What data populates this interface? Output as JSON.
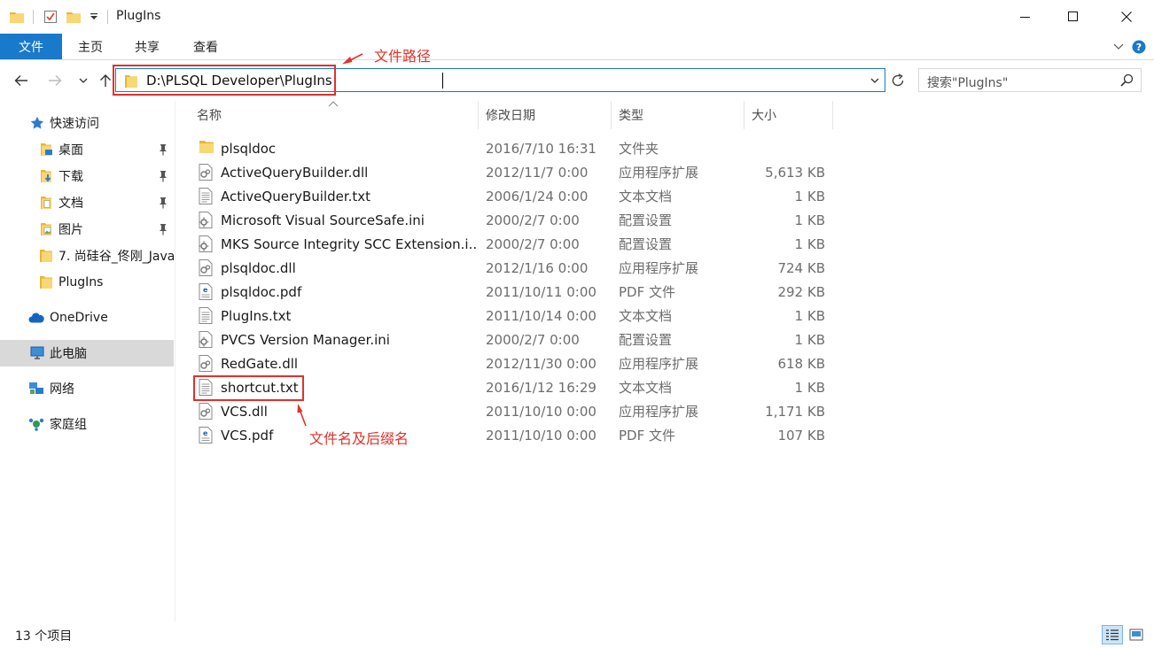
{
  "window": {
    "title": "PlugIns",
    "controls": [
      "minimize",
      "maximize",
      "close"
    ]
  },
  "ribbon": {
    "tabs": [
      {
        "label": "文件",
        "active": true
      },
      {
        "label": "主页"
      },
      {
        "label": "共享"
      },
      {
        "label": "查看"
      }
    ]
  },
  "navigation": {
    "address": "D:\\PLSQL Developer\\PlugIns",
    "search_placeholder": "搜索\"PlugIns\""
  },
  "sidebar": {
    "items": [
      {
        "label": "快速访问",
        "icon": "star-icon",
        "pinned": false
      },
      {
        "label": "桌面",
        "icon": "desktop-folder-icon",
        "pinned": true
      },
      {
        "label": "下载",
        "icon": "download-folder-icon",
        "pinned": true
      },
      {
        "label": "文档",
        "icon": "documents-folder-icon",
        "pinned": true
      },
      {
        "label": "图片",
        "icon": "pictures-folder-icon",
        "pinned": true
      },
      {
        "label": "7. 尚硅谷_佟刚_Java",
        "icon": "folder-icon",
        "pinned": false
      },
      {
        "label": "PlugIns",
        "icon": "folder-icon",
        "pinned": false
      },
      {
        "label": "OneDrive",
        "icon": "cloud-icon",
        "pinned": false
      },
      {
        "label": "此电脑",
        "icon": "computer-icon",
        "pinned": false,
        "selected": true
      },
      {
        "label": "网络",
        "icon": "network-icon",
        "pinned": false
      },
      {
        "label": "家庭组",
        "icon": "homegroup-icon",
        "pinned": false
      }
    ]
  },
  "columns": [
    {
      "label": "名称"
    },
    {
      "label": "修改日期"
    },
    {
      "label": "类型"
    },
    {
      "label": "大小"
    }
  ],
  "files": [
    {
      "name": "plsqldoc",
      "modified": "2016/7/10 16:31",
      "type": "文件夹",
      "size": "",
      "icon": "folder-icon"
    },
    {
      "name": "ActiveQueryBuilder.dll",
      "modified": "2012/11/7 0:00",
      "type": "应用程序扩展",
      "size": "5,613 KB",
      "icon": "dll-file-icon"
    },
    {
      "name": "ActiveQueryBuilder.txt",
      "modified": "2006/1/24 0:00",
      "type": "文本文档",
      "size": "1 KB",
      "icon": "text-file-icon"
    },
    {
      "name": "Microsoft Visual SourceSafe.ini",
      "modified": "2000/2/7 0:00",
      "type": "配置设置",
      "size": "1 KB",
      "icon": "ini-file-icon"
    },
    {
      "name": "MKS Source Integrity SCC Extension.i...",
      "modified": "2000/2/7 0:00",
      "type": "配置设置",
      "size": "1 KB",
      "icon": "ini-file-icon"
    },
    {
      "name": "plsqldoc.dll",
      "modified": "2012/1/16 0:00",
      "type": "应用程序扩展",
      "size": "724 KB",
      "icon": "dll-file-icon"
    },
    {
      "name": "plsqldoc.pdf",
      "modified": "2011/10/11 0:00",
      "type": "PDF 文件",
      "size": "292 KB",
      "icon": "pdf-file-icon"
    },
    {
      "name": "PlugIns.txt",
      "modified": "2011/10/14 0:00",
      "type": "文本文档",
      "size": "1 KB",
      "icon": "text-file-icon"
    },
    {
      "name": "PVCS Version Manager.ini",
      "modified": "2000/2/7 0:00",
      "type": "配置设置",
      "size": "1 KB",
      "icon": "ini-file-icon"
    },
    {
      "name": "RedGate.dll",
      "modified": "2012/11/30 0:00",
      "type": "应用程序扩展",
      "size": "618 KB",
      "icon": "dll-file-icon"
    },
    {
      "name": "shortcut.txt",
      "modified": "2016/1/12 16:29",
      "type": "文本文档",
      "size": "1 KB",
      "icon": "text-file-icon"
    },
    {
      "name": "VCS.dll",
      "modified": "2011/10/10 0:00",
      "type": "应用程序扩展",
      "size": "1,171 KB",
      "icon": "dll-file-icon"
    },
    {
      "name": "VCS.pdf",
      "modified": "2011/10/10 0:00",
      "type": "PDF 文件",
      "size": "107 KB",
      "icon": "pdf-file-icon"
    }
  ],
  "status": {
    "item_count": "13 个项目"
  },
  "annotations": {
    "path_label": "文件路径",
    "filename_label": "文件名及后缀名",
    "color": "#e0322a"
  },
  "colors": {
    "accent": "#1979ca",
    "folder": "#f4c430",
    "selected_bg": "#d9d9d9"
  }
}
